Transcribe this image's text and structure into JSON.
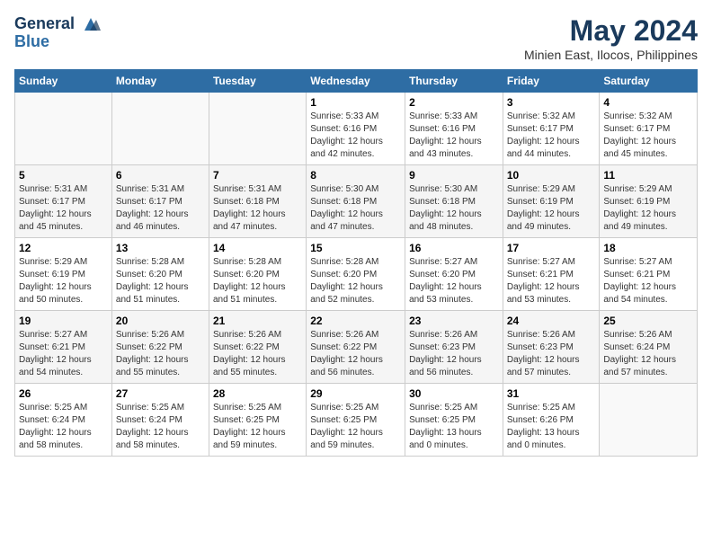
{
  "logo": {
    "line1": "General",
    "line2": "Blue"
  },
  "title": "May 2024",
  "location": "Minien East, Ilocos, Philippines",
  "weekdays": [
    "Sunday",
    "Monday",
    "Tuesday",
    "Wednesday",
    "Thursday",
    "Friday",
    "Saturday"
  ],
  "weeks": [
    [
      {
        "day": "",
        "info": ""
      },
      {
        "day": "",
        "info": ""
      },
      {
        "day": "",
        "info": ""
      },
      {
        "day": "1",
        "info": "Sunrise: 5:33 AM\nSunset: 6:16 PM\nDaylight: 12 hours\nand 42 minutes."
      },
      {
        "day": "2",
        "info": "Sunrise: 5:33 AM\nSunset: 6:16 PM\nDaylight: 12 hours\nand 43 minutes."
      },
      {
        "day": "3",
        "info": "Sunrise: 5:32 AM\nSunset: 6:17 PM\nDaylight: 12 hours\nand 44 minutes."
      },
      {
        "day": "4",
        "info": "Sunrise: 5:32 AM\nSunset: 6:17 PM\nDaylight: 12 hours\nand 45 minutes."
      }
    ],
    [
      {
        "day": "5",
        "info": "Sunrise: 5:31 AM\nSunset: 6:17 PM\nDaylight: 12 hours\nand 45 minutes."
      },
      {
        "day": "6",
        "info": "Sunrise: 5:31 AM\nSunset: 6:17 PM\nDaylight: 12 hours\nand 46 minutes."
      },
      {
        "day": "7",
        "info": "Sunrise: 5:31 AM\nSunset: 6:18 PM\nDaylight: 12 hours\nand 47 minutes."
      },
      {
        "day": "8",
        "info": "Sunrise: 5:30 AM\nSunset: 6:18 PM\nDaylight: 12 hours\nand 47 minutes."
      },
      {
        "day": "9",
        "info": "Sunrise: 5:30 AM\nSunset: 6:18 PM\nDaylight: 12 hours\nand 48 minutes."
      },
      {
        "day": "10",
        "info": "Sunrise: 5:29 AM\nSunset: 6:19 PM\nDaylight: 12 hours\nand 49 minutes."
      },
      {
        "day": "11",
        "info": "Sunrise: 5:29 AM\nSunset: 6:19 PM\nDaylight: 12 hours\nand 49 minutes."
      }
    ],
    [
      {
        "day": "12",
        "info": "Sunrise: 5:29 AM\nSunset: 6:19 PM\nDaylight: 12 hours\nand 50 minutes."
      },
      {
        "day": "13",
        "info": "Sunrise: 5:28 AM\nSunset: 6:20 PM\nDaylight: 12 hours\nand 51 minutes."
      },
      {
        "day": "14",
        "info": "Sunrise: 5:28 AM\nSunset: 6:20 PM\nDaylight: 12 hours\nand 51 minutes."
      },
      {
        "day": "15",
        "info": "Sunrise: 5:28 AM\nSunset: 6:20 PM\nDaylight: 12 hours\nand 52 minutes."
      },
      {
        "day": "16",
        "info": "Sunrise: 5:27 AM\nSunset: 6:20 PM\nDaylight: 12 hours\nand 53 minutes."
      },
      {
        "day": "17",
        "info": "Sunrise: 5:27 AM\nSunset: 6:21 PM\nDaylight: 12 hours\nand 53 minutes."
      },
      {
        "day": "18",
        "info": "Sunrise: 5:27 AM\nSunset: 6:21 PM\nDaylight: 12 hours\nand 54 minutes."
      }
    ],
    [
      {
        "day": "19",
        "info": "Sunrise: 5:27 AM\nSunset: 6:21 PM\nDaylight: 12 hours\nand 54 minutes."
      },
      {
        "day": "20",
        "info": "Sunrise: 5:26 AM\nSunset: 6:22 PM\nDaylight: 12 hours\nand 55 minutes."
      },
      {
        "day": "21",
        "info": "Sunrise: 5:26 AM\nSunset: 6:22 PM\nDaylight: 12 hours\nand 55 minutes."
      },
      {
        "day": "22",
        "info": "Sunrise: 5:26 AM\nSunset: 6:22 PM\nDaylight: 12 hours\nand 56 minutes."
      },
      {
        "day": "23",
        "info": "Sunrise: 5:26 AM\nSunset: 6:23 PM\nDaylight: 12 hours\nand 56 minutes."
      },
      {
        "day": "24",
        "info": "Sunrise: 5:26 AM\nSunset: 6:23 PM\nDaylight: 12 hours\nand 57 minutes."
      },
      {
        "day": "25",
        "info": "Sunrise: 5:26 AM\nSunset: 6:24 PM\nDaylight: 12 hours\nand 57 minutes."
      }
    ],
    [
      {
        "day": "26",
        "info": "Sunrise: 5:25 AM\nSunset: 6:24 PM\nDaylight: 12 hours\nand 58 minutes."
      },
      {
        "day": "27",
        "info": "Sunrise: 5:25 AM\nSunset: 6:24 PM\nDaylight: 12 hours\nand 58 minutes."
      },
      {
        "day": "28",
        "info": "Sunrise: 5:25 AM\nSunset: 6:25 PM\nDaylight: 12 hours\nand 59 minutes."
      },
      {
        "day": "29",
        "info": "Sunrise: 5:25 AM\nSunset: 6:25 PM\nDaylight: 12 hours\nand 59 minutes."
      },
      {
        "day": "30",
        "info": "Sunrise: 5:25 AM\nSunset: 6:25 PM\nDaylight: 13 hours\nand 0 minutes."
      },
      {
        "day": "31",
        "info": "Sunrise: 5:25 AM\nSunset: 6:26 PM\nDaylight: 13 hours\nand 0 minutes."
      },
      {
        "day": "",
        "info": ""
      }
    ]
  ]
}
